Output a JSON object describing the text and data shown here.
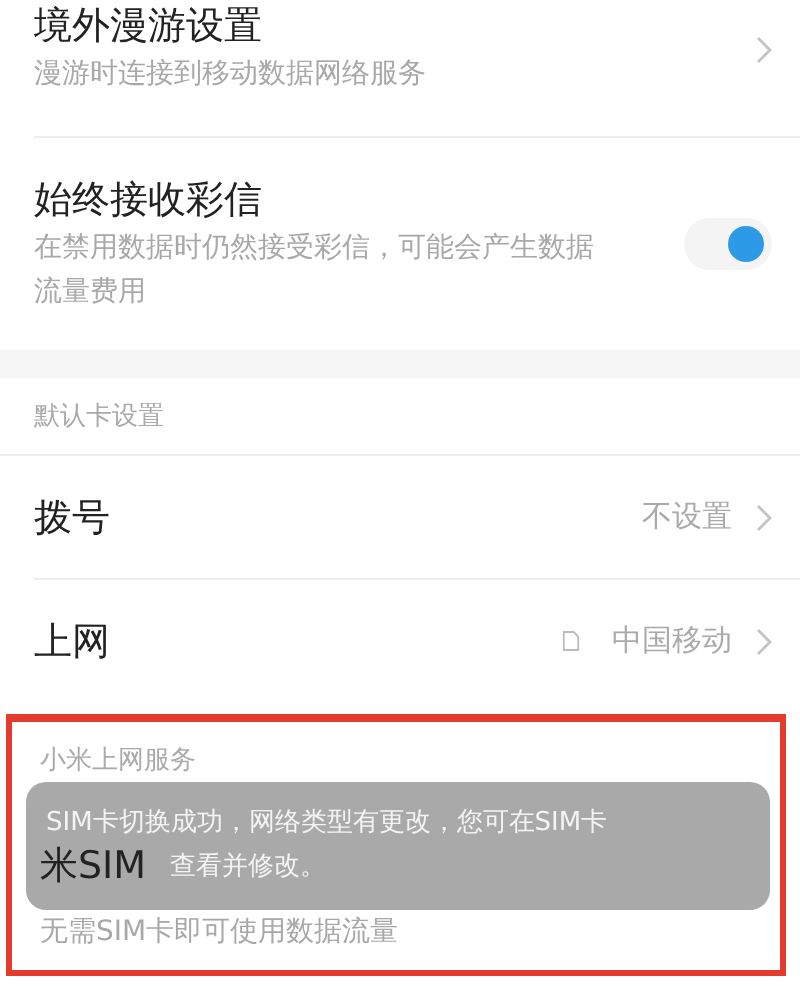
{
  "rows": [
    {
      "kind": "link",
      "title": "境外漫游设置",
      "subtitle": "漫游时连接到移动数据网络服务"
    },
    {
      "kind": "toggle",
      "title": "始终接收彩信",
      "subtitle": "在禁用数据时仍然接受彩信，可能会产生数据流量费用",
      "on": true
    }
  ],
  "sections": [
    {
      "header": "默认卡设置",
      "rows": [
        {
          "kind": "value",
          "title": "拨号",
          "value": "不设置",
          "sim_icon": false
        },
        {
          "kind": "value",
          "title": "上网",
          "value": "中国移动",
          "sim_icon": true
        }
      ]
    }
  ],
  "highlight": {
    "header": "小米上网服务",
    "title": "米SIM",
    "subtitle": "无需SIM卡即可使用数据流量"
  },
  "toast": {
    "lines": [
      "SIM卡切换成功，网络类型有更改，您可在SIM卡",
      "查看并修改。"
    ]
  }
}
